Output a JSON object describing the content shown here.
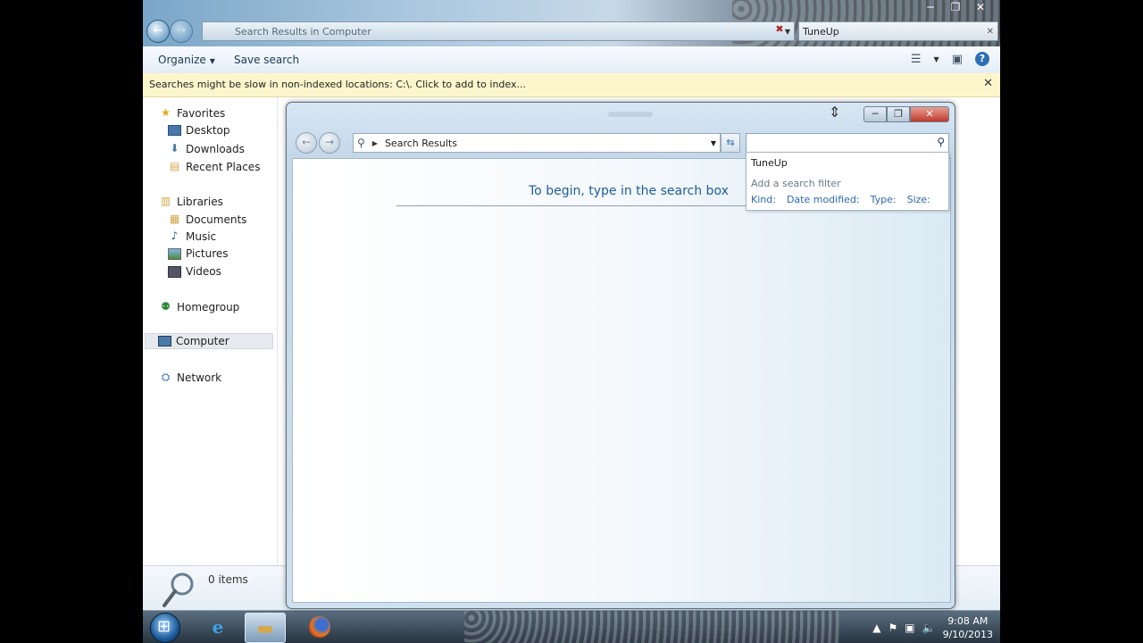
{
  "outer_window": {
    "address_path": "Search Results in Computer",
    "search_value": "TuneUp",
    "controls": [
      "─",
      "❐",
      "✕"
    ]
  },
  "command_bar": {
    "organize": "Organize",
    "save_search": "Save search"
  },
  "info_bar": {
    "message": "Searches might be slow in non-indexed locations: C:\\. Click to add to index..."
  },
  "nav_pane": {
    "favorites": "Favorites",
    "desktop": "Desktop",
    "downloads": "Downloads",
    "recent_places": "Recent Places",
    "libraries": "Libraries",
    "documents": "Documents",
    "music": "Music",
    "pictures": "Pictures",
    "videos": "Videos",
    "homegroup": "Homegroup",
    "computer": "Computer",
    "network": "Network"
  },
  "details_pane": {
    "items_count": "0 items"
  },
  "dialog": {
    "address_label": "Search Results",
    "begin_message": "To begin, type in the search box",
    "search_value": "",
    "suggestion_history": "TuneUp",
    "add_filter_label": "Add a search filter",
    "filters": {
      "kind": "Kind:",
      "date_modified": "Date modified:",
      "type": "Type:",
      "size": "Size:"
    }
  },
  "taskbar": {
    "time": "9:08 AM",
    "date": "9/10/2013"
  }
}
